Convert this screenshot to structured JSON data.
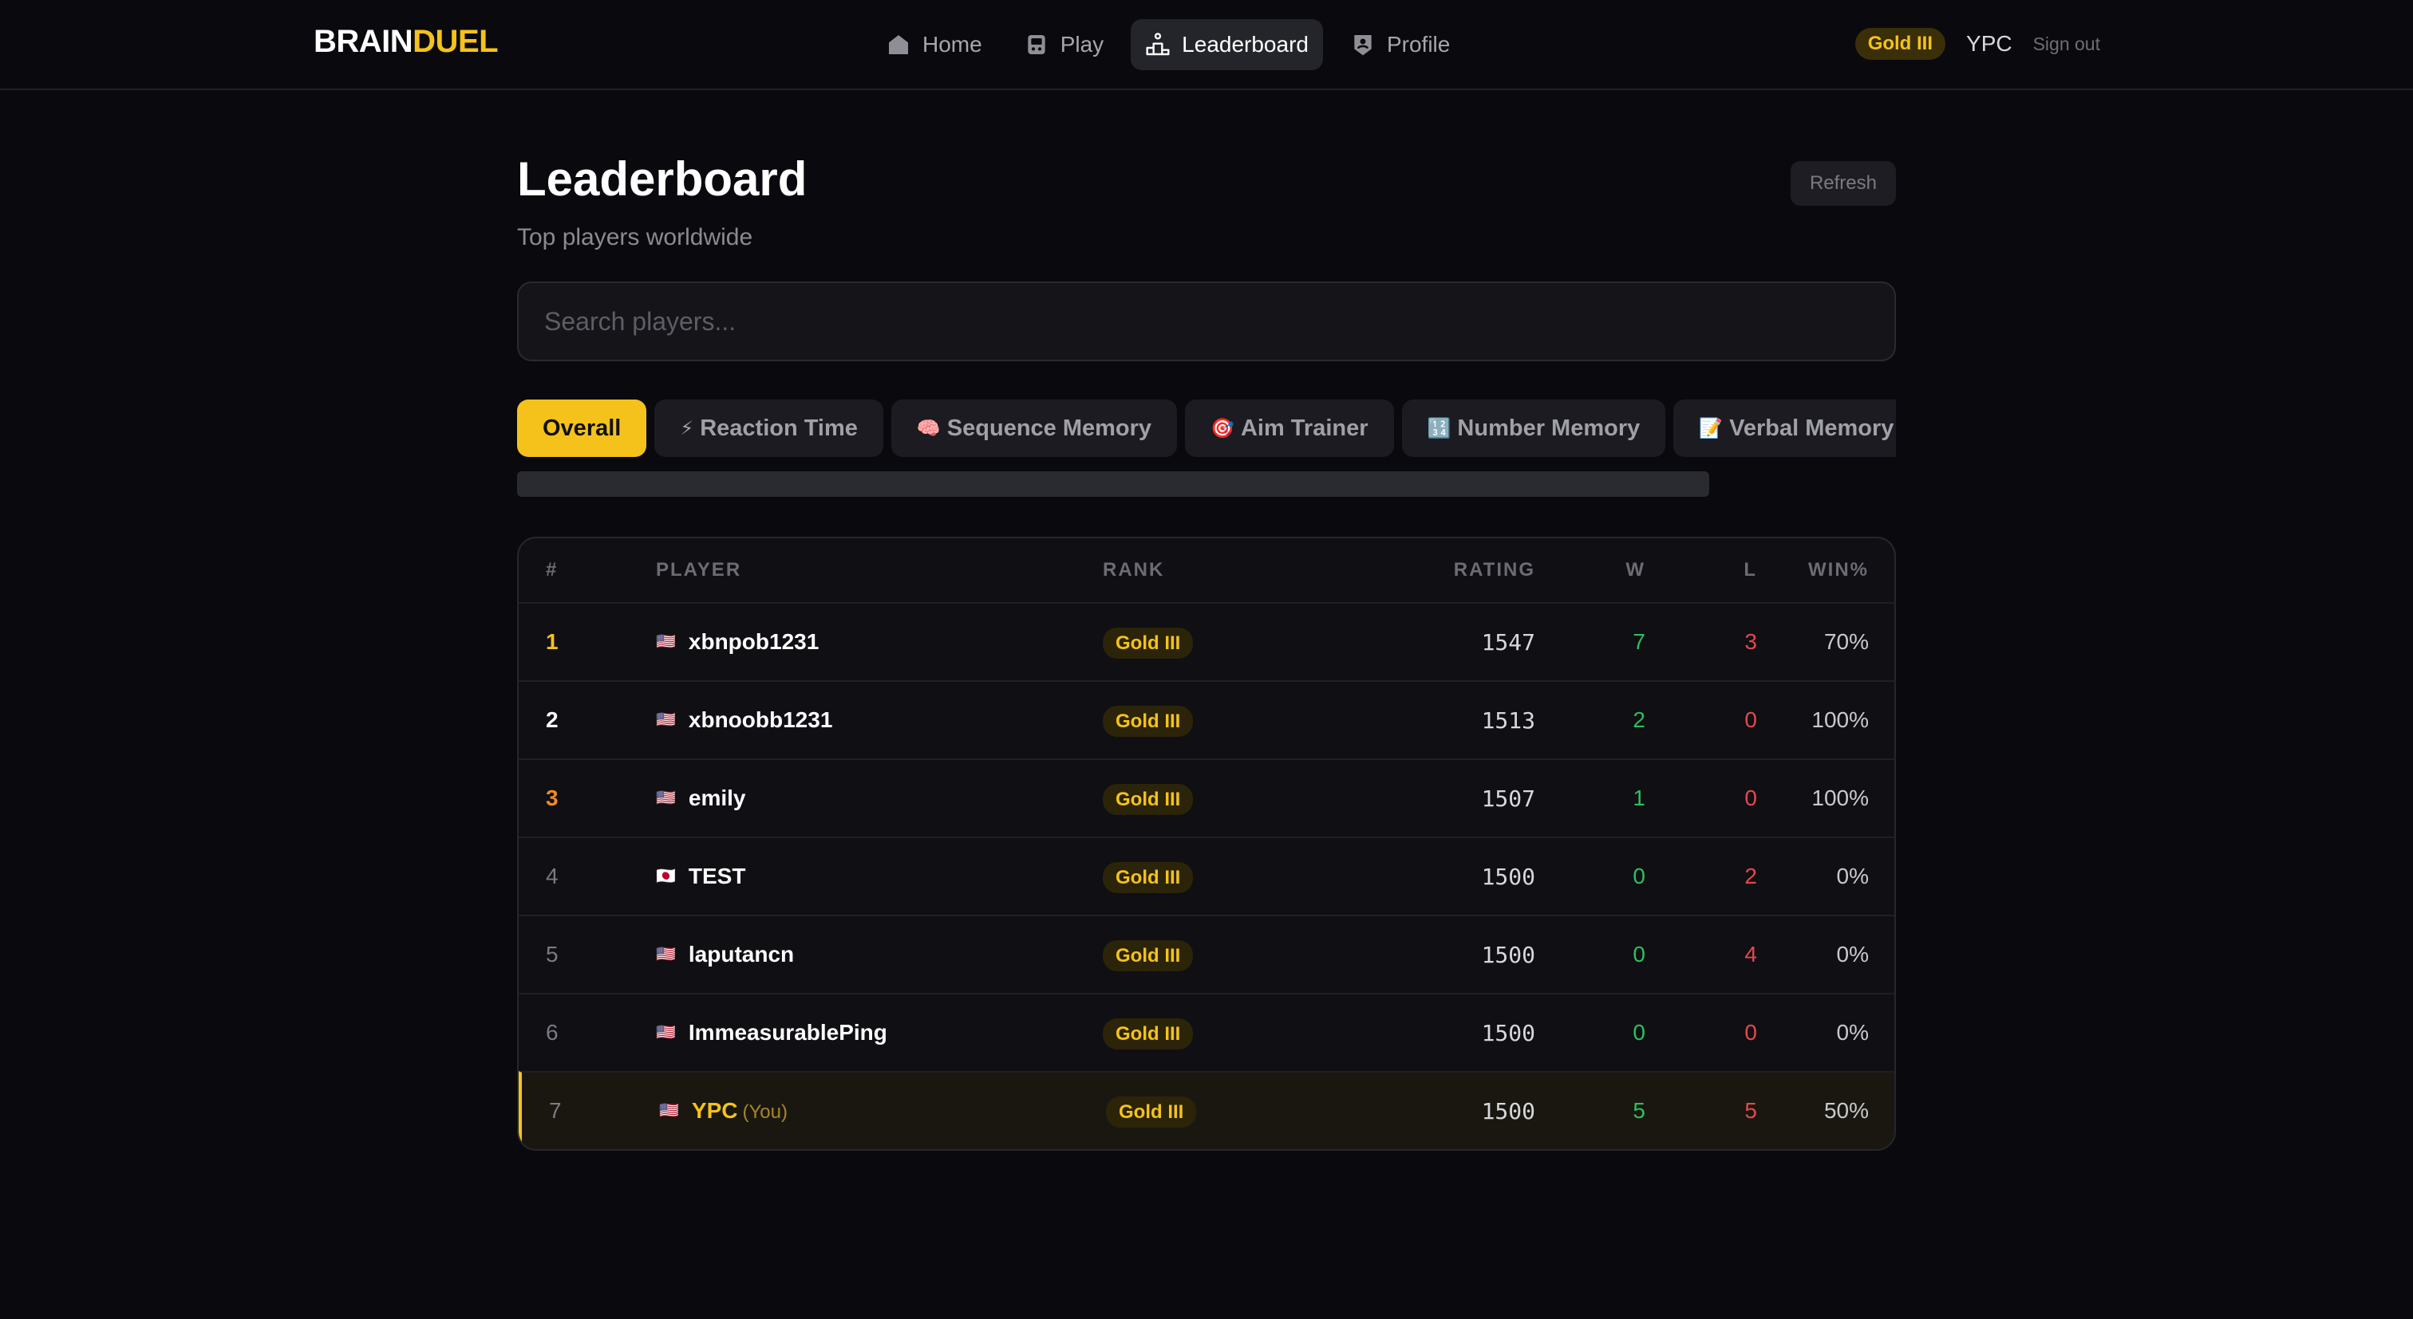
{
  "logo": {
    "part1": "BRAIN",
    "part2": "DUEL"
  },
  "nav": {
    "home": "Home",
    "play": "Play",
    "leaderboard": "Leaderboard",
    "profile": "Profile",
    "active": "leaderboard"
  },
  "user": {
    "rank_badge": "Gold III",
    "name": "YPC",
    "signout": "Sign out"
  },
  "page": {
    "title": "Leaderboard",
    "subtitle": "Top players worldwide",
    "refresh": "Refresh"
  },
  "search": {
    "placeholder": "Search players...",
    "value": ""
  },
  "tabs": [
    {
      "icon": "",
      "label": "Overall",
      "active": true
    },
    {
      "icon": "⚡",
      "label": "Reaction Time"
    },
    {
      "icon": "🧠",
      "label": "Sequence Memory"
    },
    {
      "icon": "🎯",
      "label": "Aim Trainer"
    },
    {
      "icon": "🔢",
      "label": "Number Memory"
    },
    {
      "icon": "📝",
      "label": "Verbal Memory"
    }
  ],
  "table": {
    "headers": {
      "num": "#",
      "player": "PLAYER",
      "rank": "RANK",
      "rating": "RATING",
      "w": "W",
      "l": "L",
      "pct": "WIN%"
    },
    "rows": [
      {
        "pos": "1",
        "flag": "🇺🇸",
        "name": "xbnpob1231",
        "rank": "Gold III",
        "rating": "1547",
        "w": "7",
        "l": "3",
        "pct": "70%"
      },
      {
        "pos": "2",
        "flag": "🇺🇸",
        "name": "xbnoobb1231",
        "rank": "Gold III",
        "rating": "1513",
        "w": "2",
        "l": "0",
        "pct": "100%"
      },
      {
        "pos": "3",
        "flag": "🇺🇸",
        "name": "emily",
        "rank": "Gold III",
        "rating": "1507",
        "w": "1",
        "l": "0",
        "pct": "100%"
      },
      {
        "pos": "4",
        "flag": "🇯🇵",
        "name": "TEST",
        "rank": "Gold III",
        "rating": "1500",
        "w": "0",
        "l": "2",
        "pct": "0%"
      },
      {
        "pos": "5",
        "flag": "🇺🇸",
        "name": "laputancn",
        "rank": "Gold III",
        "rating": "1500",
        "w": "0",
        "l": "4",
        "pct": "0%"
      },
      {
        "pos": "6",
        "flag": "🇺🇸",
        "name": "ImmeasurablePing",
        "rank": "Gold III",
        "rating": "1500",
        "w": "0",
        "l": "0",
        "pct": "0%"
      },
      {
        "pos": "7",
        "flag": "🇺🇸",
        "name": "YPC",
        "you_tag": "(You)",
        "rank": "Gold III",
        "rating": "1500",
        "w": "5",
        "l": "5",
        "pct": "50%"
      }
    ]
  },
  "colors": {
    "accent": "#f5c21b",
    "win": "#2fbf5d",
    "loss": "#e5484d",
    "bronze": "#f08a24",
    "background": "#0a0a0e"
  }
}
